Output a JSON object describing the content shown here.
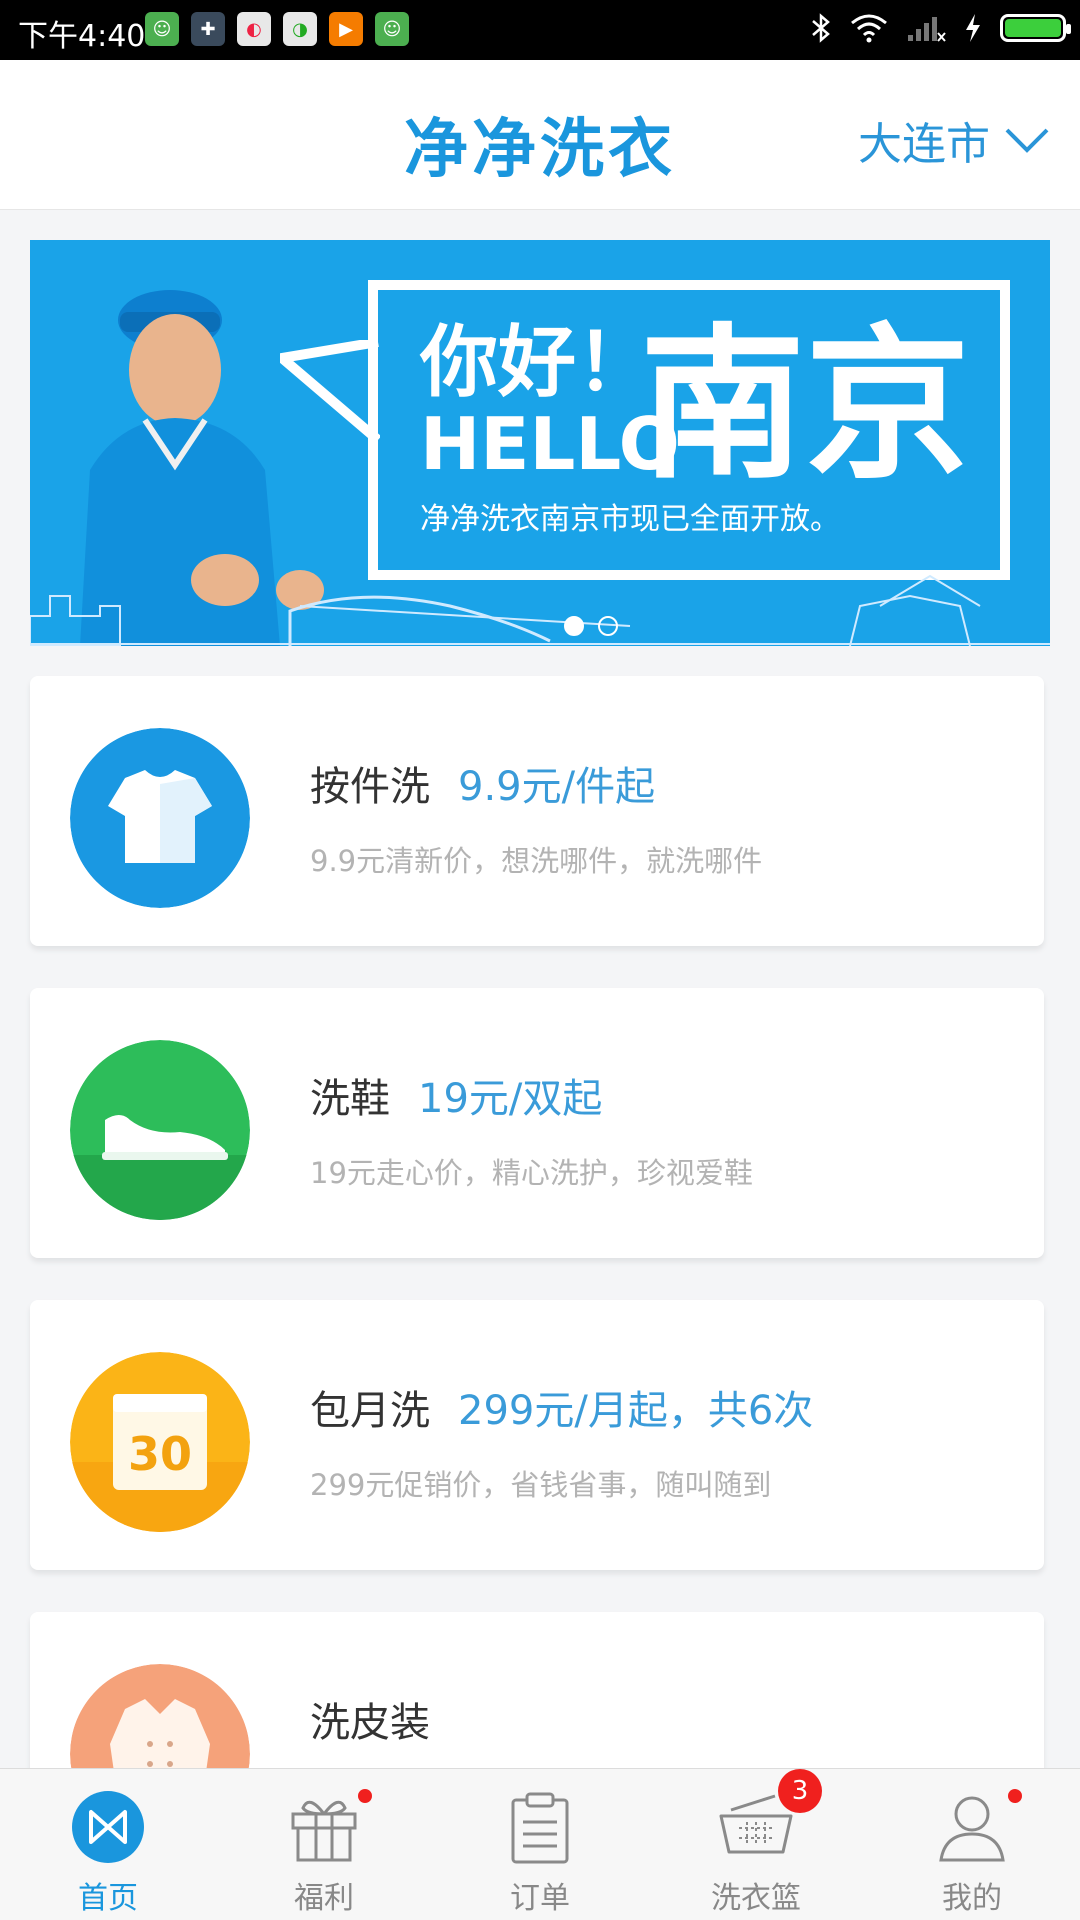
{
  "status_bar": {
    "time": "下午4:40"
  },
  "header": {
    "logo": "净净洗衣",
    "city": "大连市"
  },
  "banner": {
    "greeting_cn": "你好！",
    "greeting_en": "HELLO",
    "city": "南京",
    "subtitle": "净净洗衣南京市现已全面开放。",
    "slide_count": 2,
    "active_slide": 1
  },
  "services": [
    {
      "name": "按件洗",
      "price": "9.9元/件起",
      "desc": "9.9元清新价，想洗哪件，就洗哪件",
      "icon": "tshirt-icon",
      "color": "#1a98e2"
    },
    {
      "name": "洗鞋",
      "price": "19元/双起",
      "desc": "19元走心价，精心洗护，珍视爱鞋",
      "icon": "shoe-icon",
      "color": "#2dbd5a"
    },
    {
      "name": "包月洗",
      "price": "299元/月起，共6次",
      "desc": "299元促销价，省钱省事，随叫随到",
      "icon": "calendar-30-icon",
      "calendar_day": "30",
      "color": "#fbb417"
    },
    {
      "name": "洗皮装",
      "price": "",
      "desc": "",
      "icon": "leather-jacket-icon",
      "color": "#f5a27a"
    }
  ],
  "tabbar": {
    "items": [
      {
        "label": "首页",
        "icon": "home-logo-icon",
        "active": true
      },
      {
        "label": "福利",
        "icon": "gift-icon",
        "dot": true
      },
      {
        "label": "订单",
        "icon": "clipboard-icon"
      },
      {
        "label": "洗衣篮",
        "icon": "basket-icon",
        "badge": "3"
      },
      {
        "label": "我的",
        "icon": "person-icon",
        "dot": true
      }
    ]
  },
  "colors": {
    "brand": "#1a96dd",
    "price": "#3a9bd9",
    "badge": "#f0201e"
  }
}
